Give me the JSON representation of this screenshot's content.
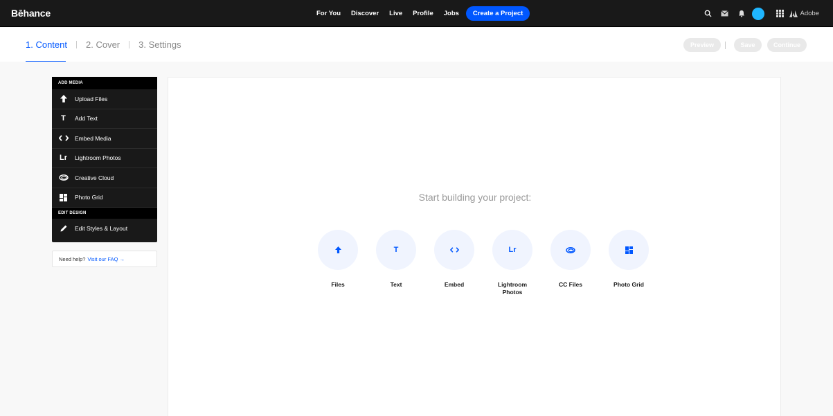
{
  "brand": "Behance",
  "nav": {
    "items": [
      "For You",
      "Discover",
      "Live",
      "Profile",
      "Jobs"
    ],
    "create_label": "Create a Project",
    "adobe_label": "Adobe"
  },
  "colors": {
    "accent": "#0057ff",
    "avatar": "#1fb6ff",
    "topbar": "#191919"
  },
  "steps": [
    {
      "label": "1. Content",
      "active": true
    },
    {
      "label": "2. Cover",
      "active": false
    },
    {
      "label": "3. Settings",
      "active": false
    }
  ],
  "actions": {
    "preview": "Preview",
    "save": "Save",
    "continue": "Continue"
  },
  "panel": {
    "add_media_heading": "ADD MEDIA",
    "items": [
      {
        "label": "Upload Files",
        "icon": "upload-arrow-icon"
      },
      {
        "label": "Add Text",
        "icon": "text-icon"
      },
      {
        "label": "Embed Media",
        "icon": "code-icon"
      },
      {
        "label": "Lightroom Photos",
        "icon": "lightroom-icon"
      },
      {
        "label": "Creative Cloud",
        "icon": "creative-cloud-icon"
      },
      {
        "label": "Photo Grid",
        "icon": "grid-icon"
      }
    ],
    "edit_design_heading": "EDIT DESIGN",
    "edit_item": {
      "label": "Edit Styles & Layout",
      "icon": "pencil-icon"
    }
  },
  "help": {
    "text": "Need help?",
    "link": "Visit our FAQ →"
  },
  "canvas": {
    "prompt": "Start building your project:",
    "tiles": [
      {
        "label": "Files",
        "icon": "upload-arrow-icon"
      },
      {
        "label": "Text",
        "icon": "text-icon",
        "glyph": "T"
      },
      {
        "label": "Embed",
        "icon": "code-icon"
      },
      {
        "label": "Lightroom Photos",
        "icon": "lightroom-icon",
        "glyph": "Lr"
      },
      {
        "label": "CC Files",
        "icon": "creative-cloud-icon"
      },
      {
        "label": "Photo Grid",
        "icon": "grid-icon"
      }
    ]
  }
}
